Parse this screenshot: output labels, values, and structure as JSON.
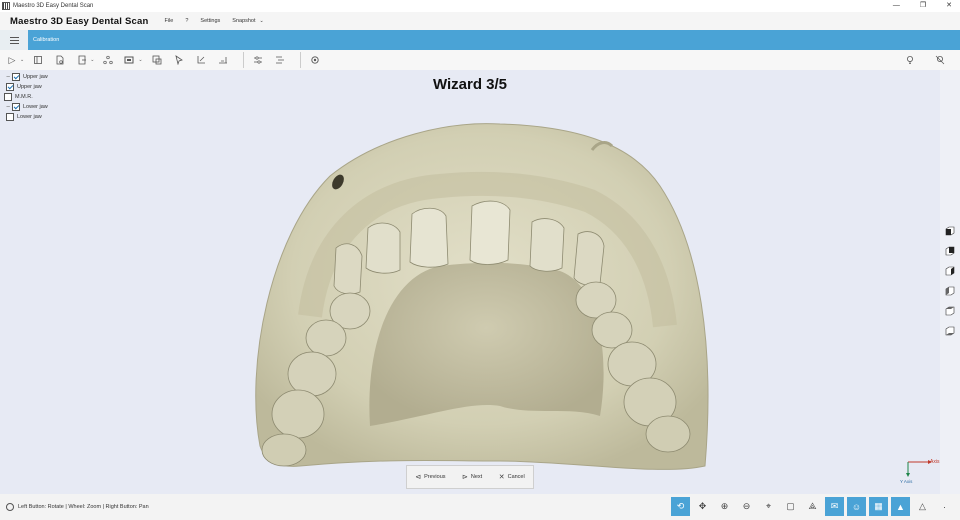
{
  "window": {
    "title": "Maestro 3D Easy Dental Scan",
    "controls": [
      "—",
      "❐",
      "✕"
    ]
  },
  "menubar": {
    "app_name": "Maestro 3D Easy Dental Scan",
    "items": [
      "File",
      "?",
      "Settings",
      "Snapshot"
    ]
  },
  "ribbon": {
    "active_tab": "Calibration"
  },
  "tree": {
    "items": [
      {
        "label": "Upper jaw",
        "checked": true,
        "group": true
      },
      {
        "label": "Upper jaw",
        "checked": true,
        "group": false
      },
      {
        "label": "M.M.R.",
        "checked": false,
        "group": false
      },
      {
        "label": "Lower jaw",
        "checked": true,
        "group": true
      },
      {
        "label": "Lower jaw",
        "checked": false,
        "group": false
      }
    ]
  },
  "wizard": {
    "title": "Wizard 3/5",
    "previous_label": "Previous",
    "next_label": "Next",
    "cancel_label": "Cancel"
  },
  "axis": {
    "x_label": "Axis",
    "y_label": "Y Axis"
  },
  "status": {
    "hint": "Left Button: Rotate | Wheel: Zoom | Right Button: Pan"
  },
  "colors": {
    "accent": "#4aa3d6",
    "viewport_bg": "#e7eaf4",
    "model": "#d9d6bd"
  }
}
